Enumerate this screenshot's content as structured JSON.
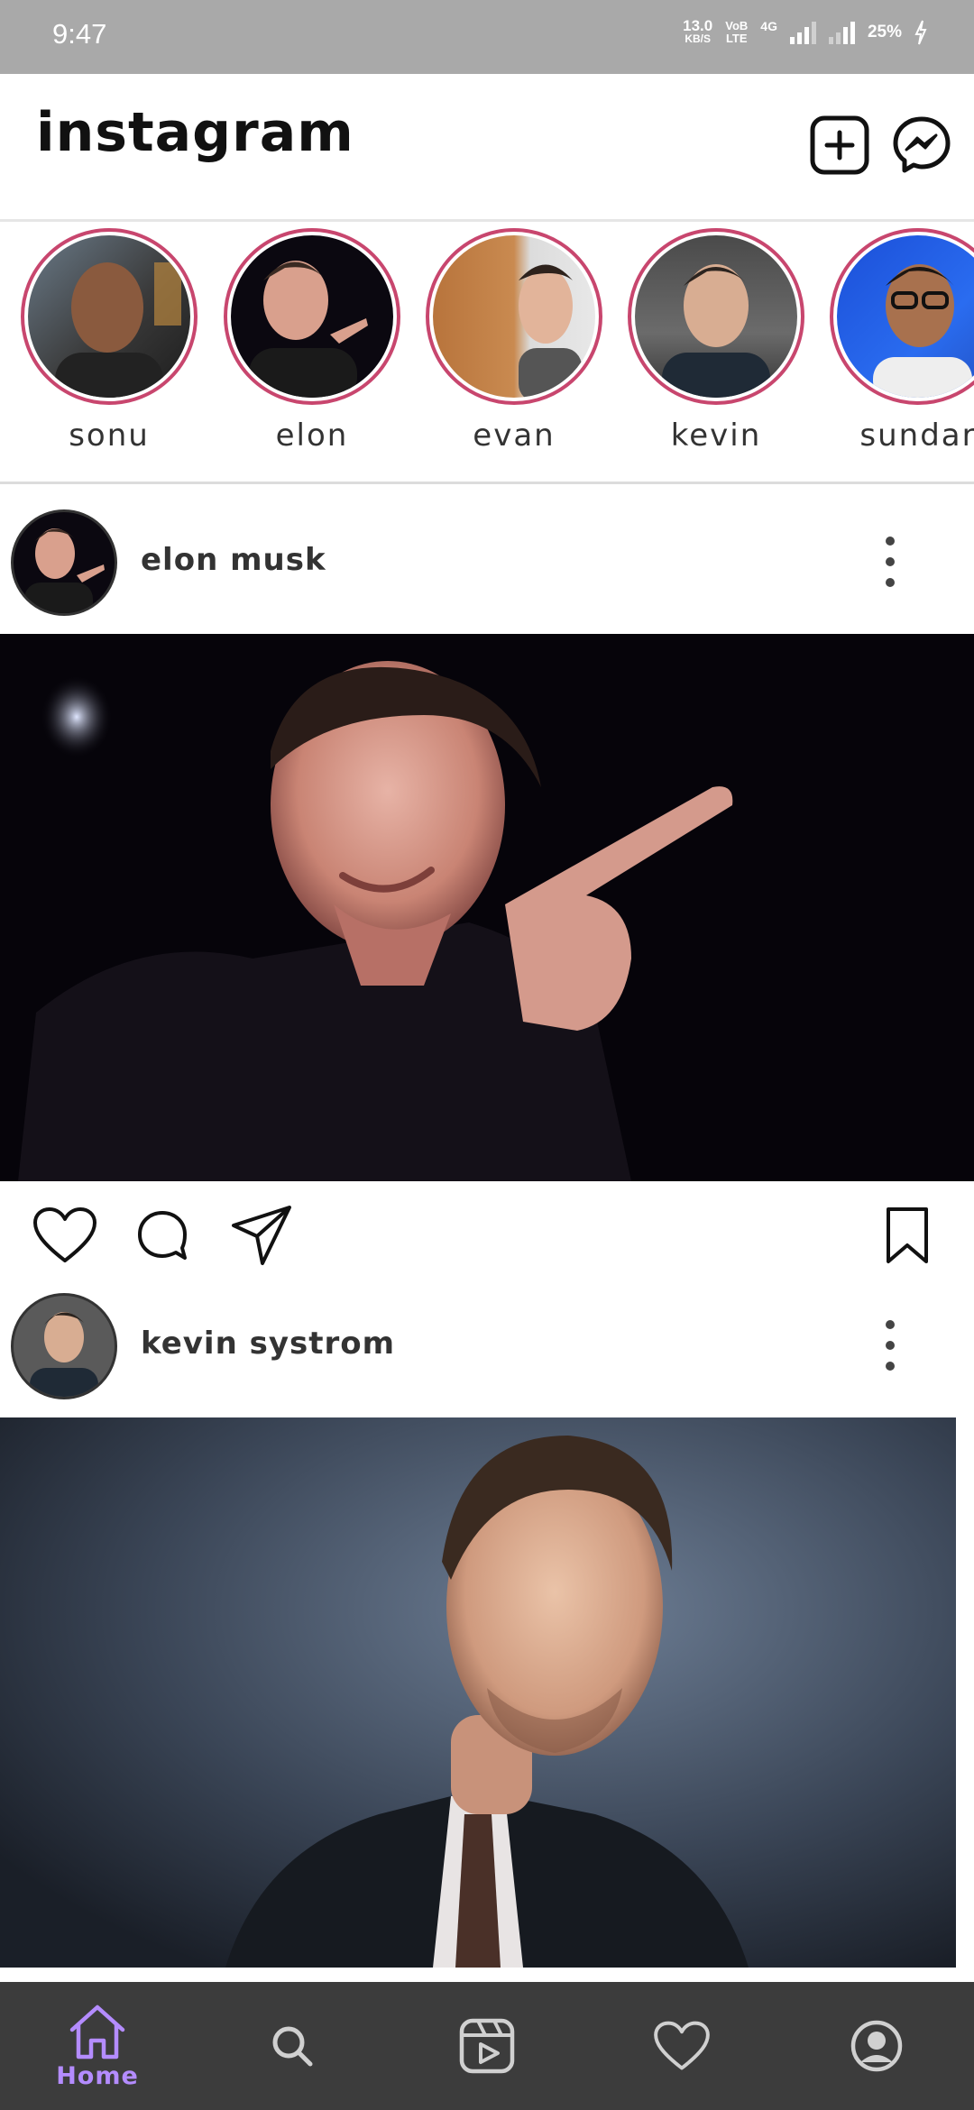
{
  "status_bar": {
    "time": "9:47",
    "net_speed": "13.0",
    "net_unit": "KB/S",
    "volte_top": "VoB",
    "volte_bottom": "LTE",
    "net_type": "4G",
    "battery": "25%"
  },
  "header": {
    "logo": "instagram",
    "add_icon": "plus-square-icon",
    "messenger_icon": "messenger-icon"
  },
  "stories": [
    {
      "label": "sonu"
    },
    {
      "label": "elon"
    },
    {
      "label": "evan"
    },
    {
      "label": "kevin"
    },
    {
      "label": "sundar"
    }
  ],
  "posts": [
    {
      "username": "elon musk"
    },
    {
      "username": "kevin systrom"
    }
  ],
  "actions": {
    "like_icon": "heart-icon",
    "comment_icon": "comment-icon",
    "share_icon": "send-icon",
    "save_icon": "bookmark-icon"
  },
  "bottom_nav": {
    "items": [
      {
        "label": "Home",
        "icon": "home-icon",
        "active": true
      },
      {
        "label": "",
        "icon": "search-icon",
        "active": false
      },
      {
        "label": "",
        "icon": "reels-icon",
        "active": false
      },
      {
        "label": "",
        "icon": "heart-icon",
        "active": false
      },
      {
        "label": "",
        "icon": "profile-icon",
        "active": false
      }
    ]
  },
  "colors": {
    "story_ring": "#c8466e",
    "status_bar": "#a9a9a9",
    "nav_bg": "#3c3c3c",
    "nav_active": "#b48cff"
  }
}
